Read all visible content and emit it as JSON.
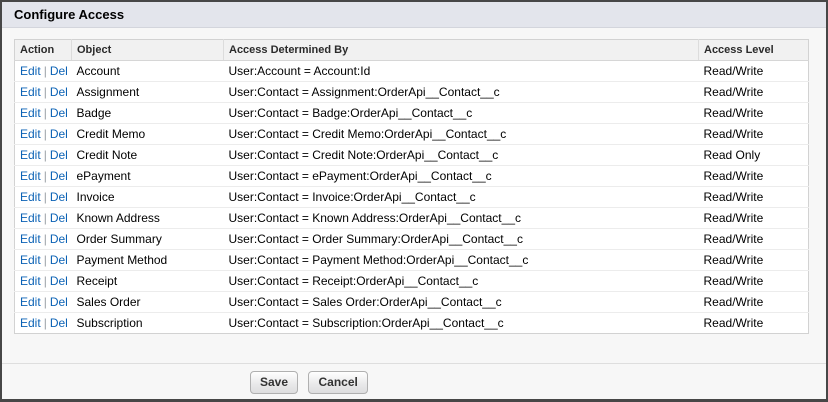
{
  "title": "Configure Access",
  "table": {
    "headers": [
      "Action",
      "Object",
      "Access Determined By",
      "Access Level"
    ],
    "action_links": {
      "edit": "Edit",
      "separator": "|",
      "del": "Del"
    },
    "rows": [
      {
        "object": "Account",
        "access_determined_by": "User:Account = Account:Id",
        "access_level": "Read/Write"
      },
      {
        "object": "Assignment",
        "access_determined_by": "User:Contact = Assignment:OrderApi__Contact__c",
        "access_level": "Read/Write"
      },
      {
        "object": "Badge",
        "access_determined_by": "User:Contact = Badge:OrderApi__Contact__c",
        "access_level": "Read/Write"
      },
      {
        "object": "Credit Memo",
        "access_determined_by": "User:Contact = Credit Memo:OrderApi__Contact__c",
        "access_level": "Read/Write"
      },
      {
        "object": "Credit Note",
        "access_determined_by": "User:Contact = Credit Note:OrderApi__Contact__c",
        "access_level": "Read Only"
      },
      {
        "object": "ePayment",
        "access_determined_by": "User:Contact = ePayment:OrderApi__Contact__c",
        "access_level": "Read/Write"
      },
      {
        "object": "Invoice",
        "access_determined_by": "User:Contact = Invoice:OrderApi__Contact__c",
        "access_level": "Read/Write"
      },
      {
        "object": "Known Address",
        "access_determined_by": "User:Contact = Known Address:OrderApi__Contact__c",
        "access_level": "Read/Write"
      },
      {
        "object": "Order Summary",
        "access_determined_by": "User:Contact = Order Summary:OrderApi__Contact__c",
        "access_level": "Read/Write"
      },
      {
        "object": "Payment Method",
        "access_determined_by": "User:Contact = Payment Method:OrderApi__Contact__c",
        "access_level": "Read/Write"
      },
      {
        "object": "Receipt",
        "access_determined_by": "User:Contact = Receipt:OrderApi__Contact__c",
        "access_level": "Read/Write"
      },
      {
        "object": "Sales Order",
        "access_determined_by": "User:Contact = Sales Order:OrderApi__Contact__c",
        "access_level": "Read/Write"
      },
      {
        "object": "Subscription",
        "access_determined_by": "User:Contact = Subscription:OrderApi__Contact__c",
        "access_level": "Read/Write"
      }
    ]
  },
  "buttons": {
    "save": "Save",
    "cancel": "Cancel"
  },
  "colors": {
    "link": "#0b62b5",
    "titlebar_bg": "#e3e5ec",
    "table_header_bg": "#f1f1f1",
    "page_bg": "#f7f7f7",
    "window_border": "#474747"
  }
}
